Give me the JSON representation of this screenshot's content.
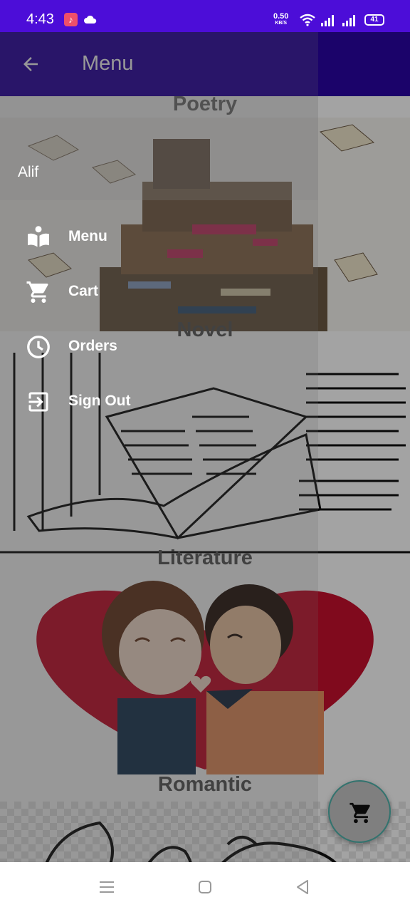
{
  "status_bar": {
    "time": "4:43",
    "net_speed_value": "0.50",
    "net_speed_unit": "KB/S",
    "battery": "41"
  },
  "app_bar": {
    "title": "Menu"
  },
  "categories": [
    {
      "title": "Poetry"
    },
    {
      "title": "Novel"
    },
    {
      "title": "Literature"
    },
    {
      "title": "Romantic"
    }
  ],
  "drawer": {
    "user_name": "Alif",
    "items": [
      {
        "label": "Menu",
        "icon": "menu-book-icon"
      },
      {
        "label": "Cart",
        "icon": "cart-icon"
      },
      {
        "label": "Orders",
        "icon": "clock-icon"
      },
      {
        "label": "Sign Out",
        "icon": "sign-out-icon"
      }
    ]
  },
  "fab": {
    "icon": "cart-icon"
  },
  "colors": {
    "status_bar": "#4c0dd8",
    "app_bar": "#2b06a6",
    "fab_border": "#4fb4ad"
  }
}
